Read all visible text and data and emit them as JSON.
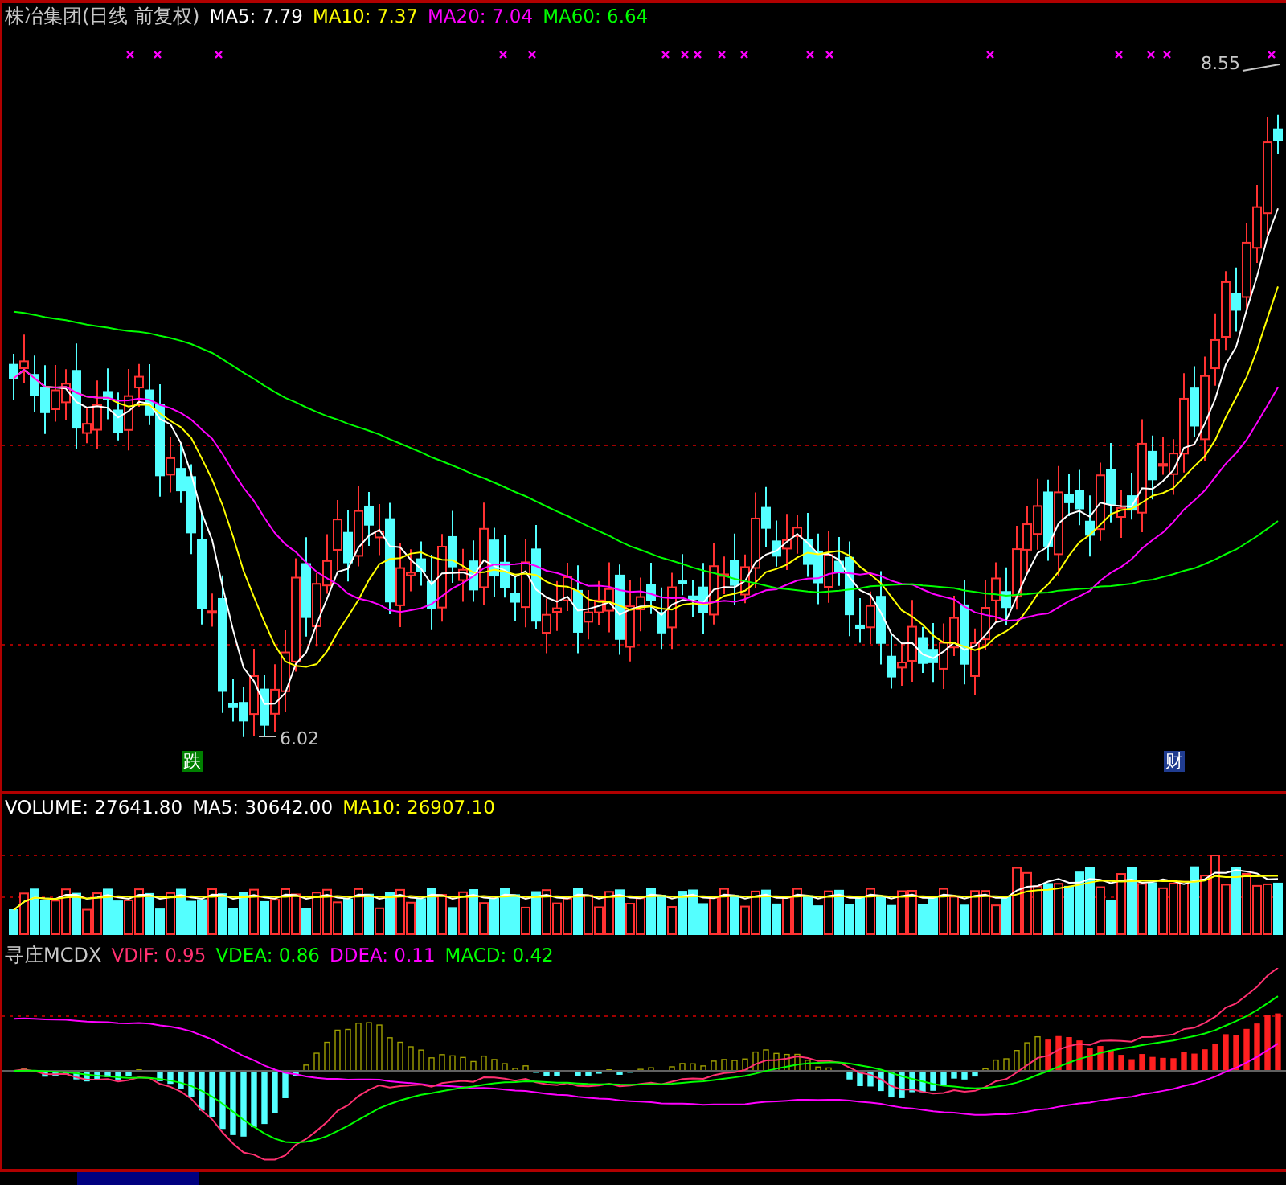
{
  "title": "株冶集团(日线 前复权)",
  "ma_legend": [
    {
      "text": "MA5: 7.79",
      "color": "#ffffff"
    },
    {
      "text": "MA10: 7.37",
      "color": "#ffff00"
    },
    {
      "text": "MA20: 7.04",
      "color": "#ff00ff"
    },
    {
      "text": "MA60: 6.64",
      "color": "#00ff00"
    }
  ],
  "price_labels": {
    "high": "8.55",
    "low": "6.02"
  },
  "signals": [
    {
      "label": "跌",
      "kind": "fall"
    },
    {
      "label": "财",
      "kind": "finance"
    }
  ],
  "volume_legend": [
    {
      "text": "VOLUME: 27641.80",
      "color": "#ffffff"
    },
    {
      "text": "MA5: 30642.00",
      "color": "#ffffff"
    },
    {
      "text": "MA10: 26907.10",
      "color": "#ffff00"
    }
  ],
  "indicator": {
    "name": "寻庄MCDX",
    "legend": [
      {
        "text": "VDIF: 0.95",
        "color": "#ff3070"
      },
      {
        "text": "VDEA: 0.86",
        "color": "#00ff00"
      },
      {
        "text": "DDEA: 0.11",
        "color": "#ff00ff"
      },
      {
        "text": "MACD: 0.42",
        "color": "#00ff00"
      }
    ]
  }
}
